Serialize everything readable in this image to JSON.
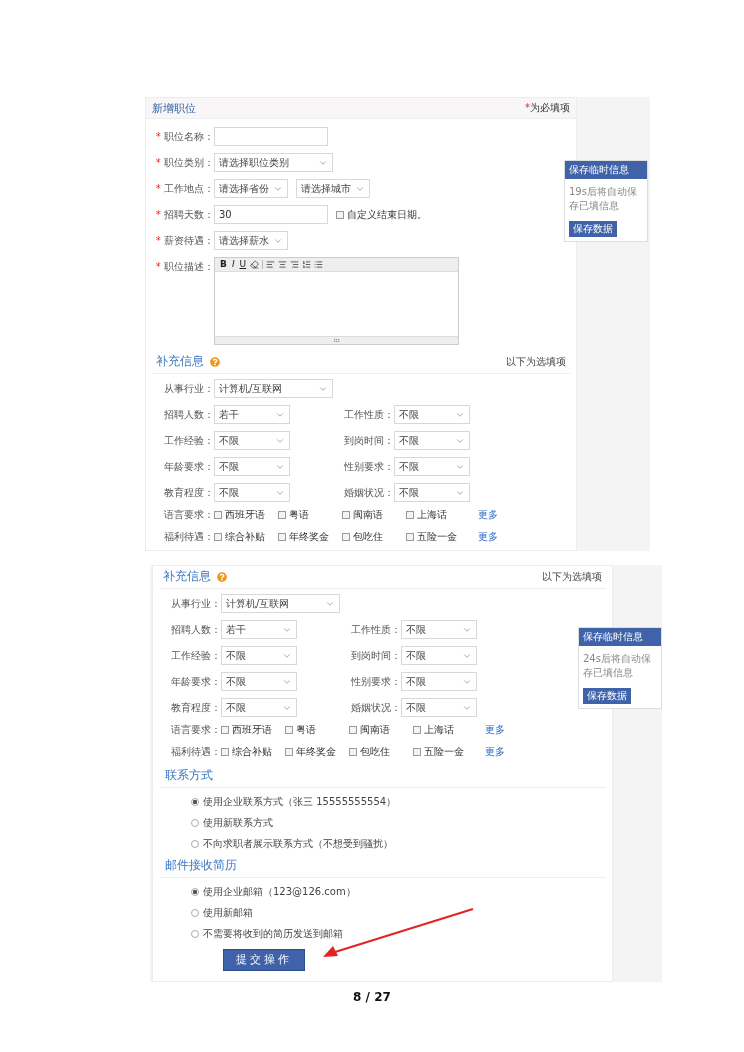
{
  "screenshot_1": {
    "header": {
      "title": "新增职位",
      "note_mark": "*",
      "note": "为必填项"
    },
    "required_fields": [
      {
        "kind": "text",
        "mark": "*",
        "label": "职位名称："
      },
      {
        "kind": "select",
        "mark": "*",
        "label": "职位类别：",
        "value": "请选择职位类别"
      },
      {
        "kind": "select-pair",
        "mark": "*",
        "label": "工作地点：",
        "value": "请选择省份",
        "second_value": "请选择城市"
      },
      {
        "kind": "days",
        "mark": "*",
        "label": "招聘天数：",
        "value": "30",
        "checkbox_label": "自定义结束日期。",
        "checked": false
      },
      {
        "kind": "select-short",
        "mark": "*",
        "label": "薪资待遇：",
        "value": "请选择薪水"
      },
      {
        "kind": "editor",
        "mark": "*",
        "label": "职位描述：",
        "toolbar": [
          {
            "kind": "bold",
            "label": "B"
          },
          {
            "kind": "italic",
            "label": "I"
          },
          {
            "kind": "underline",
            "label": "U"
          },
          {
            "kind": "eraser"
          },
          {
            "kind": "separator"
          },
          {
            "kind": "align-left"
          },
          {
            "kind": "align-center"
          },
          {
            "kind": "align-right"
          },
          {
            "kind": "ordered-list"
          },
          {
            "kind": "bullet-list"
          }
        ]
      }
    ],
    "save_panel": {
      "title": "保存临时信息",
      "text": "19s后将自动保存已填信息",
      "button": "保存数据"
    },
    "supplement": {
      "title": "补充信息",
      "note": "以下为选填项",
      "industry": {
        "label": "从事行业：",
        "value": "计算机/互联网"
      },
      "pairs": [
        [
          {
            "label": "招聘人数：",
            "value": "若干"
          },
          {
            "label": "工作性质：",
            "value": "不限"
          }
        ],
        [
          {
            "label": "工作经验：",
            "value": "不限"
          },
          {
            "label": "到岗时间：",
            "value": "不限"
          }
        ],
        [
          {
            "label": "年龄要求：",
            "value": "不限"
          },
          {
            "label": "性别要求：",
            "value": "不限"
          }
        ],
        [
          {
            "label": "教育程度：",
            "value": "不限"
          },
          {
            "label": "婚姻状况：",
            "value": "不限"
          }
        ]
      ],
      "check_groups": [
        {
          "label": "语言要求：",
          "options": [
            {
              "label": "西班牙语",
              "checked": false
            },
            {
              "label": "粤语",
              "checked": false
            },
            {
              "label": "闽南语",
              "checked": false
            },
            {
              "label": "上海话",
              "checked": false
            }
          ],
          "more": "更多"
        },
        {
          "label": "福利待遇：",
          "options": [
            {
              "label": "综合补贴",
              "checked": false
            },
            {
              "label": "年终奖金",
              "checked": false
            },
            {
              "label": "包吃住",
              "checked": false
            },
            {
              "label": "五险一金",
              "checked": false
            }
          ],
          "more": "更多"
        }
      ]
    }
  },
  "screenshot_2": {
    "supplement": {
      "title": "补充信息",
      "note": "以下为选填项",
      "industry": {
        "label": "从事行业：",
        "value": "计算机/互联网"
      },
      "pairs": [
        [
          {
            "label": "招聘人数：",
            "value": "若干"
          },
          {
            "label": "工作性质：",
            "value": "不限"
          }
        ],
        [
          {
            "label": "工作经验：",
            "value": "不限"
          },
          {
            "label": "到岗时间：",
            "value": "不限"
          }
        ],
        [
          {
            "label": "年龄要求：",
            "value": "不限"
          },
          {
            "label": "性别要求：",
            "value": "不限"
          }
        ],
        [
          {
            "label": "教育程度：",
            "value": "不限"
          },
          {
            "label": "婚姻状况：",
            "value": "不限"
          }
        ]
      ],
      "check_groups": [
        {
          "label": "语言要求：",
          "options": [
            {
              "label": "西班牙语",
              "checked": false
            },
            {
              "label": "粤语",
              "checked": false
            },
            {
              "label": "闽南语",
              "checked": false
            },
            {
              "label": "上海话",
              "checked": false
            }
          ],
          "more": "更多"
        },
        {
          "label": "福利待遇：",
          "options": [
            {
              "label": "综合补贴",
              "checked": false
            },
            {
              "label": "年终奖金",
              "checked": false
            },
            {
              "label": "包吃住",
              "checked": false
            },
            {
              "label": "五险一金",
              "checked": false
            }
          ],
          "more": "更多"
        }
      ]
    },
    "save_panel": {
      "title": "保存临时信息",
      "text": "24s后将自动保存已填信息",
      "button": "保存数据"
    },
    "contact": {
      "title": "联系方式",
      "options": [
        {
          "label": "使用企业联系方式（张三 15555555554）",
          "selected": true
        },
        {
          "label": "使用新联系方式",
          "selected": false
        },
        {
          "label": "不向求职者展示联系方式（不想受到骚扰）",
          "selected": false
        }
      ]
    },
    "resume_email": {
      "title": "邮件接收简历",
      "options": [
        {
          "label": "使用企业邮箱（123@126.com）",
          "selected": true
        },
        {
          "label": "使用新邮箱",
          "selected": false
        },
        {
          "label": "不需要将收到的简历发送到邮箱",
          "selected": false
        }
      ]
    },
    "submit_button": "提交操作"
  },
  "page_number": "8 / 27"
}
